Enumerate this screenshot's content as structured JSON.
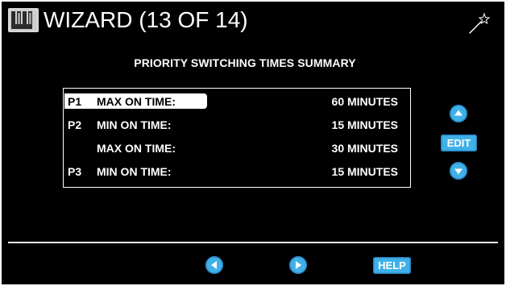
{
  "header": {
    "title": "WIZARD (13 OF 14)",
    "logo_icon": "um-logo-icon",
    "wand_icon": "magic-wand-icon"
  },
  "summary": {
    "heading": "PRIORITY SWITCHING TIMES SUMMARY",
    "rows": [
      {
        "priority": "P1",
        "label": "MAX ON TIME:",
        "value": "60 MINUTES",
        "selected": true
      },
      {
        "priority": "P2",
        "label": "MIN ON TIME:",
        "value": "15 MINUTES",
        "selected": false
      },
      {
        "priority": "",
        "label": "MAX ON TIME:",
        "value": "30 MINUTES",
        "selected": false
      },
      {
        "priority": "P3",
        "label": "MIN ON TIME:",
        "value": "15 MINUTES",
        "selected": false
      }
    ]
  },
  "side_controls": {
    "up_icon": "chevron-up-icon",
    "edit_label": "EDIT",
    "down_icon": "chevron-down-icon"
  },
  "footer": {
    "back_icon": "chevron-left-icon",
    "next_icon": "chevron-right-icon",
    "help_label": "HELP"
  },
  "colors": {
    "background": "#000000",
    "text": "#ffffff",
    "accent": "#3fb1e8"
  }
}
